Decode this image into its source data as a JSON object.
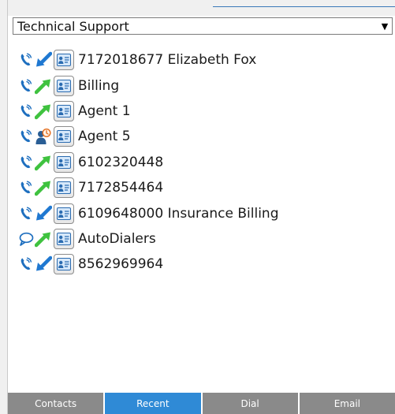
{
  "queue_select": {
    "value": "Technical Support"
  },
  "recent_calls": [
    {
      "label": "7172018677 Elizabeth Fox",
      "channel": "phone",
      "direction": "inbound"
    },
    {
      "label": "Billing",
      "channel": "phone",
      "direction": "outbound"
    },
    {
      "label": "Agent 1",
      "channel": "phone",
      "direction": "outbound"
    },
    {
      "label": "Agent 5",
      "channel": "phone",
      "direction": "missed"
    },
    {
      "label": "6102320448",
      "channel": "phone",
      "direction": "outbound"
    },
    {
      "label": "7172854464",
      "channel": "phone",
      "direction": "outbound"
    },
    {
      "label": "6109648000 Insurance Billing",
      "channel": "phone",
      "direction": "inbound"
    },
    {
      "label": "AutoDialers",
      "channel": "chat",
      "direction": "outbound"
    },
    {
      "label": "8562969964",
      "channel": "phone",
      "direction": "inbound"
    }
  ],
  "tabs": [
    {
      "label": "Contacts",
      "active": false
    },
    {
      "label": "Recent",
      "active": true
    },
    {
      "label": "Dial",
      "active": false
    },
    {
      "label": "Email",
      "active": false
    }
  ],
  "colors": {
    "accent": "#2f8ad6",
    "inbound_arrow": "#1f78d1",
    "outbound_arrow": "#3fc23f",
    "missed": "#e36b1b"
  }
}
